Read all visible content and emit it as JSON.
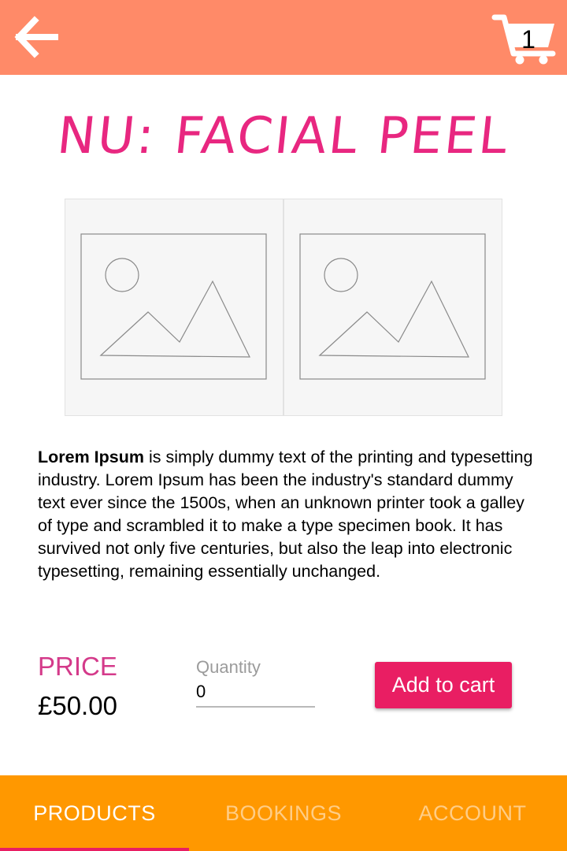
{
  "header": {
    "back_icon": "arrow-left-icon",
    "cart_icon": "shopping-cart-icon",
    "cart_count": "1",
    "background_color": "#ff8a68"
  },
  "product": {
    "title": "Nu: Facial Peel",
    "image_icons": [
      "image-placeholder-icon",
      "image-placeholder-icon"
    ],
    "description_bold": "Lorem Ipsum",
    "description_text": " is simply dummy text of the printing and typesetting industry. Lorem Ipsum has been the industry's standard dummy text ever since the 1500s, when an unknown printer took a galley of type and scrambled it to make a type specimen book. It has survived not only five centuries, but also the leap into electronic typesetting, remaining essentially unchanged.",
    "price_label": "PRICE",
    "price": "£50.00"
  },
  "quantity": {
    "label": "Quantity",
    "value": "0"
  },
  "actions": {
    "add_to_cart": "Add to cart"
  },
  "bottom_nav": {
    "tabs": [
      {
        "label": "PRODUCTS",
        "active": true
      },
      {
        "label": "BOOKINGS",
        "active": false
      },
      {
        "label": "ACCOUNT",
        "active": false
      }
    ],
    "background_color": "#ff9800",
    "indicator_color": "#e91e63"
  },
  "colors": {
    "accent": "#e91e63",
    "title": "#e82780",
    "price_label": "#d43a8a"
  }
}
